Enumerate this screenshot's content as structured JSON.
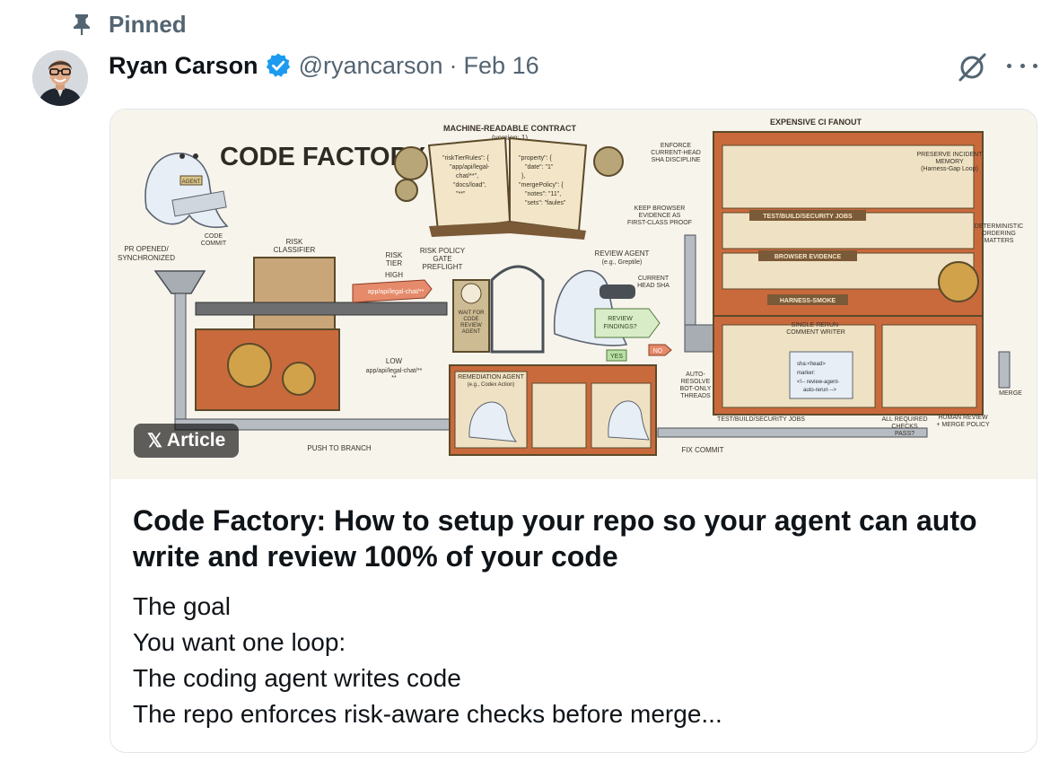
{
  "pinned": {
    "label": "Pinned",
    "icon": "pin-icon"
  },
  "tweet": {
    "author_name": "Ryan Carson",
    "handle": "@ryancarson",
    "separator": "·",
    "date": "Feb 16",
    "verified_color": "#1d9bf0"
  },
  "card": {
    "badge": {
      "logo": "𝕏",
      "label": "Article"
    },
    "title": "Code Factory: How to setup your repo so your agent can auto write and review 100% of your code",
    "excerpt": [
      "The goal",
      "You want one loop:",
      "The coding agent writes code",
      "The repo enforces risk-aware checks before merge..."
    ]
  },
  "illustration": {
    "title": "CODE FACTORY",
    "labels": {
      "contract": "MACHINE-READABLE CONTRACT",
      "contract_version": "(version: 1)",
      "contract_left_page": [
        "\"riskTierRules\": {",
        "\"app/api/legal-",
        "chat/**\",",
        "\"docs/load\",",
        "\"**\""
      ],
      "contract_right_page": [
        "\"property\": {",
        "\"date\": \"1\"",
        "},",
        "\"mergePolicy\": {",
        "\"notes\": \"11\",",
        "\"sets\": \"faules\""
      ],
      "ci_fanout": "EXPENSIVE CI FANOUT",
      "enforce": [
        "ENFORCE",
        "CURRENT-HEAD",
        "SHA DISCIPLINE"
      ],
      "preserve": [
        "PRESERVE INCIDENT",
        "MEMORY",
        "(Harness-Gap Loop)"
      ],
      "code_commit": [
        "CODE",
        "COMMIT"
      ],
      "risk_classifier": [
        "RISK",
        "CLASSIFIER"
      ],
      "pr_opened": [
        "PR OPENED/",
        "SYNCHRONIZED"
      ],
      "risk_tier": [
        "RISK",
        "TIER"
      ],
      "risk_policy": [
        "RISK POLICY",
        "GATE",
        "PREFLIGHT"
      ],
      "high": "HIGH",
      "high_path": "app/api/legal-chat/**",
      "low": "LOW",
      "low_path": [
        "app/api/legal-chat/**",
        "**"
      ],
      "keep_browser": [
        "KEEP BROWSER",
        "EVIDENCE AS",
        "FIRST-CLASS PROOF"
      ],
      "review_agent": [
        "REVIEW AGENT",
        "(e.g., Greptile)"
      ],
      "current_head": [
        "CURRENT",
        "HEAD SHA"
      ],
      "wait_for": [
        "WAIT FOR",
        "CODE",
        "REVIEW",
        "AGENT"
      ],
      "review_findings": [
        "REVIEW",
        "FINDINGS?"
      ],
      "yes": "YES",
      "no": "NO",
      "remediation": [
        "REMEDIATION AGENT",
        "(e.g., Codex Action)"
      ],
      "auto_resolve": [
        "AUTO-",
        "RESOLVE",
        "BOT-ONLY",
        "THREADS"
      ],
      "test_jobs": "TEST/BUILD/SECURITY JOBS",
      "browser_evidence": "BROWSER EVIDENCE",
      "harness_smoke": "HARNESS-SMOKE",
      "single_rerun": [
        "SINGLE RERUN-",
        "COMMENT WRITER"
      ],
      "rerun_code": [
        "sha:<head>",
        "marker:",
        "<!-- review-agent-",
        "auto-rerun -->"
      ],
      "deterministic": [
        "DETERMINISTIC",
        "ORDERING",
        "MATTERS"
      ],
      "merge": "MERGE",
      "test_jobs_bottom": "TEST/BUILD/SECURITY JOBS",
      "all_required": [
        "ALL REQUIRED",
        "CHECKS",
        "PASS?"
      ],
      "human_review": [
        "HUMAN REVIEW",
        "+ MERGE POLICY"
      ],
      "fix_commit": "FIX COMMIT",
      "push_to_branch": "PUSH TO BRANCH",
      "agent_tag": "AGENT"
    }
  },
  "colors": {
    "text_primary": "#0f1419",
    "text_secondary": "#536471",
    "verified": "#1d9bf0",
    "card_border": "#e1e6ea",
    "paper": "#f7f4ec",
    "ink": "#3a3226",
    "brick": "#c96a3d"
  }
}
